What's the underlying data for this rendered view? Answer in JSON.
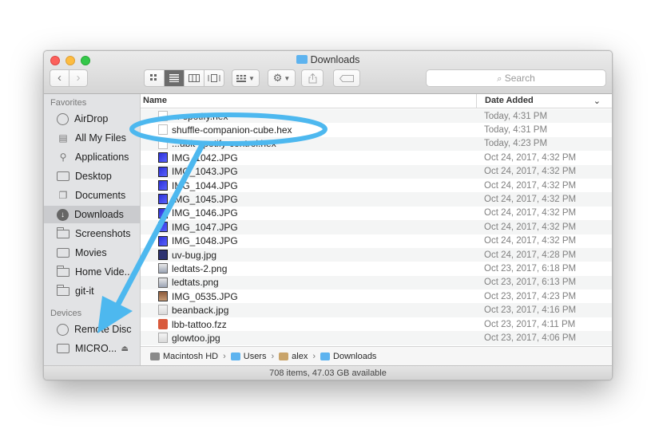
{
  "window": {
    "title": "Downloads"
  },
  "toolbar": {
    "back_icon": "chevron-left-icon",
    "forward_icon": "chevron-right-icon",
    "view_modes": [
      "icon-view",
      "list-view",
      "column-view",
      "cover-flow-view"
    ],
    "active_view": "list-view",
    "search_placeholder": "Search"
  },
  "sidebar": {
    "favorites_heading": "Favorites",
    "favorites": [
      {
        "label": "AirDrop",
        "icon": "airdrop-icon"
      },
      {
        "label": "All My Files",
        "icon": "all-files-icon"
      },
      {
        "label": "Applications",
        "icon": "applications-icon"
      },
      {
        "label": "Desktop",
        "icon": "desktop-icon"
      },
      {
        "label": "Documents",
        "icon": "documents-icon"
      },
      {
        "label": "Downloads",
        "icon": "downloads-icon",
        "selected": true
      },
      {
        "label": "Screenshots",
        "icon": "folder-icon"
      },
      {
        "label": "Movies",
        "icon": "movies-icon"
      },
      {
        "label": "Home Vide...",
        "icon": "folder-icon"
      },
      {
        "label": "git-it",
        "icon": "folder-icon"
      }
    ],
    "devices_heading": "Devices",
    "devices": [
      {
        "label": "Remote Disc",
        "icon": "remote-disc-icon"
      },
      {
        "label": "MICRO...",
        "icon": "drive-icon",
        "eject": "⏏"
      }
    ]
  },
  "columns": {
    "name": "Name",
    "date": "Date Added",
    "sort_icon": "chevron-down-icon"
  },
  "files": [
    {
      "name": "...-spotify.hex",
      "date": "Today, 4:31 PM",
      "icon": "ic-doc"
    },
    {
      "name": "shuffle-companion-cube.hex",
      "date": "Today, 4:31 PM",
      "icon": "ic-doc"
    },
    {
      "name": "...ubit-spotify-control.hex",
      "date": "Today, 4:23 PM",
      "icon": "ic-doc"
    },
    {
      "name": "IMG_1042.JPG",
      "date": "Oct 24, 2017, 4:32 PM",
      "icon": "ic-img"
    },
    {
      "name": "IMG_1043.JPG",
      "date": "Oct 24, 2017, 4:32 PM",
      "icon": "ic-img"
    },
    {
      "name": "IMG_1044.JPG",
      "date": "Oct 24, 2017, 4:32 PM",
      "icon": "ic-img"
    },
    {
      "name": "IMG_1045.JPG",
      "date": "Oct 24, 2017, 4:32 PM",
      "icon": "ic-img"
    },
    {
      "name": "IMG_1046.JPG",
      "date": "Oct 24, 2017, 4:32 PM",
      "icon": "ic-img"
    },
    {
      "name": "IMG_1047.JPG",
      "date": "Oct 24, 2017, 4:32 PM",
      "icon": "ic-img"
    },
    {
      "name": "IMG_1048.JPG",
      "date": "Oct 24, 2017, 4:32 PM",
      "icon": "ic-img"
    },
    {
      "name": "uv-bug.jpg",
      "date": "Oct 24, 2017, 4:28 PM",
      "icon": "ic-uv"
    },
    {
      "name": "ledtats-2.png",
      "date": "Oct 23, 2017, 6:18 PM",
      "icon": "ic-png"
    },
    {
      "name": "ledtats.png",
      "date": "Oct 23, 2017, 6:13 PM",
      "icon": "ic-png"
    },
    {
      "name": "IMG_0535.JPG",
      "date": "Oct 23, 2017, 4:23 PM",
      "icon": "ic-0535"
    },
    {
      "name": "beanback.jpg",
      "date": "Oct 23, 2017, 4:16 PM",
      "icon": "ic-jpgw"
    },
    {
      "name": "lbb-tattoo.fzz",
      "date": "Oct 23, 2017, 4:11 PM",
      "icon": "ic-fzz"
    },
    {
      "name": "glowtoo.jpg",
      "date": "Oct 23, 2017, 4:06 PM",
      "icon": "ic-jpgw"
    }
  ],
  "pathbar": [
    {
      "label": "Macintosh HD",
      "icon": "hard-drive-icon",
      "color": "#8a8a8a"
    },
    {
      "label": "Users",
      "icon": "folder-icon",
      "color": "#5db3ef"
    },
    {
      "label": "alex",
      "icon": "home-icon",
      "color": "#c9a46a"
    },
    {
      "label": "Downloads",
      "icon": "folder-icon",
      "color": "#5db3ef"
    }
  ],
  "status": {
    "text": "708 items, 47.03 GB available"
  },
  "annotation": {
    "color": "#4db8ef",
    "highlighted_file": "shuffle-companion-cube.hex",
    "target_device": "MICRO..."
  }
}
